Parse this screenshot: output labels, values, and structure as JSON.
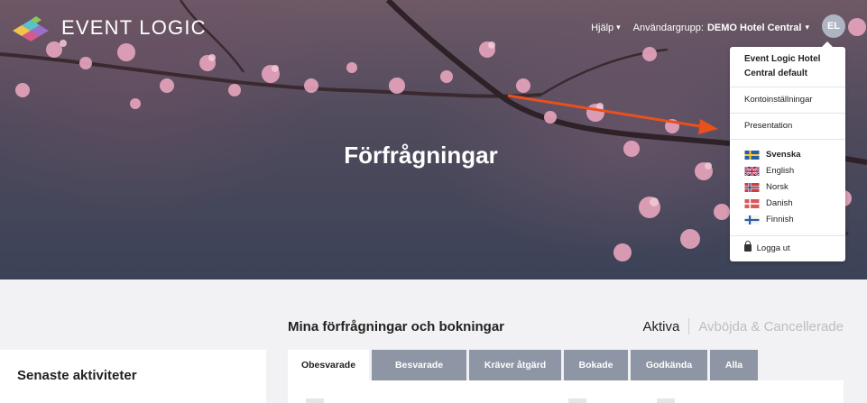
{
  "brand": {
    "name": "EVENT LOGIC"
  },
  "header": {
    "help_label": "Hjälp",
    "user_group_label": "Användargrupp:",
    "user_group_value": "DEMO Hotel Central",
    "avatar_initials": "EL"
  },
  "hero": {
    "title": "Förfrågningar"
  },
  "dropdown": {
    "account_name": "Event Logic Hotel Central default",
    "items": [
      "Kontoinställningar",
      "Presentation"
    ],
    "languages": [
      {
        "label": "Svenska",
        "flag": "flag-se-icon",
        "active": true
      },
      {
        "label": "English",
        "flag": "flag-gb-icon",
        "active": false
      },
      {
        "label": "Norsk",
        "flag": "flag-no-icon",
        "active": false
      },
      {
        "label": "Danish",
        "flag": "flag-dk-icon",
        "active": false
      },
      {
        "label": "Finnish",
        "flag": "flag-fi-icon",
        "active": false
      }
    ],
    "logout_label": "Logga ut"
  },
  "sidebar": {
    "recent_title": "Senaste aktiviteter"
  },
  "main": {
    "title": "Mina förfrågningar och bokningar",
    "filter_active": "Aktiva",
    "filter_inactive": "Avböjda & Cancellerade",
    "tabs": [
      "Obesvarade",
      "Besvarade",
      "Kräver åtgärd",
      "Bokade",
      "Godkända",
      "Alla"
    ]
  },
  "colors": {
    "accent_arrow": "#e8501e",
    "tab_inactive": "#8e95a4",
    "avatar": "#aeb5c2"
  }
}
